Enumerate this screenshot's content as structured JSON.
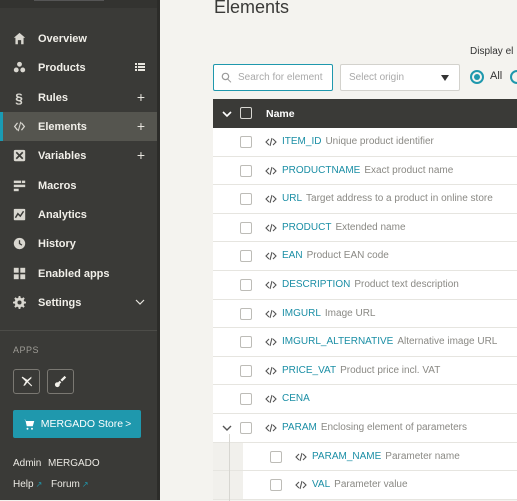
{
  "sidebar": {
    "items": [
      {
        "label": "Overview",
        "icon": "home-icon",
        "suffix": ""
      },
      {
        "label": "Products",
        "icon": "products-icon",
        "suffix": "list"
      },
      {
        "label": "Rules",
        "icon": "section-icon",
        "suffix": "+"
      },
      {
        "label": "Elements",
        "icon": "code-icon",
        "suffix": "+"
      },
      {
        "label": "Variables",
        "icon": "variable-icon",
        "suffix": "+"
      },
      {
        "label": "Macros",
        "icon": "macro-icon",
        "suffix": ""
      },
      {
        "label": "Analytics",
        "icon": "chart-icon",
        "suffix": ""
      },
      {
        "label": "History",
        "icon": "clock-icon",
        "suffix": ""
      },
      {
        "label": "Enabled apps",
        "icon": "apps-grid-icon",
        "suffix": ""
      },
      {
        "label": "Settings",
        "icon": "gear-icon",
        "suffix": "chevron"
      }
    ],
    "active_index": 3,
    "apps_heading": "APPS",
    "store_label": "MERGADO Store",
    "store_arrow": ">",
    "admin_label": "Admin",
    "admin_name": "MERGADO",
    "help_label": "Help",
    "forum_label": "Forum"
  },
  "main": {
    "title": "Elements",
    "display_label": "Display el",
    "search_placeholder": "Search for element",
    "origin_placeholder": "Select origin",
    "radio_all_label": "All",
    "table_header": "Name",
    "rows": [
      {
        "name": "ITEM_ID",
        "desc": "Unique product identifier",
        "level": 0,
        "expand": false
      },
      {
        "name": "PRODUCTNAME",
        "desc": "Exact product name",
        "level": 0,
        "expand": false
      },
      {
        "name": "URL",
        "desc": "Target address to a product in online store",
        "level": 0,
        "expand": false
      },
      {
        "name": "PRODUCT",
        "desc": "Extended name",
        "level": 0,
        "expand": false
      },
      {
        "name": "EAN",
        "desc": "Product EAN code",
        "level": 0,
        "expand": false
      },
      {
        "name": "DESCRIPTION",
        "desc": "Product text description",
        "level": 0,
        "expand": false
      },
      {
        "name": "IMGURL",
        "desc": "Image URL",
        "level": 0,
        "expand": false
      },
      {
        "name": "IMGURL_ALTERNATIVE",
        "desc": "Alternative image URL",
        "level": 0,
        "expand": false
      },
      {
        "name": "PRICE_VAT",
        "desc": "Product price incl. VAT",
        "level": 0,
        "expand": false
      },
      {
        "name": "CENA",
        "desc": "",
        "level": 0,
        "expand": false
      },
      {
        "name": "PARAM",
        "desc": "Enclosing element of parameters",
        "level": 0,
        "expand": true
      },
      {
        "name": "PARAM_NAME",
        "desc": "Parameter name",
        "level": 1,
        "expand": false
      },
      {
        "name": "VAL",
        "desc": "Parameter value",
        "level": 1,
        "expand": false
      }
    ]
  },
  "colors": {
    "accent": "#1f98ad",
    "sidebar": "#3a3a37",
    "active": "#55554f",
    "link": "#1a8ea5"
  }
}
